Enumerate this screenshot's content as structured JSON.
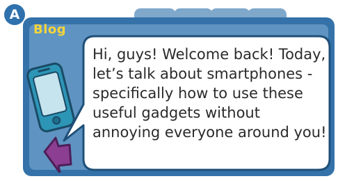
{
  "badge": {
    "label": "A"
  },
  "blog": {
    "label": "Blog"
  },
  "post": {
    "lines": [
      "Hi, guys! Welcome back! Today,",
      "let’s talk about smartphones -",
      "specifically how to use these",
      "useful gadgets without",
      "annoying everyone around you!"
    ]
  },
  "icons": {
    "phone": "smartphone-icon",
    "arrow": "back-arrow-icon"
  },
  "colors": {
    "badge": "#2e71ad",
    "panel_border": "#3472a9",
    "panel_fill": "#5f94c2",
    "tabs": "#7fa8cb",
    "blog_label": "#f3d43a",
    "phone_body": "#2d95b5",
    "phone_screen": "#c6e4ee",
    "arrow": "#8c3f92"
  }
}
